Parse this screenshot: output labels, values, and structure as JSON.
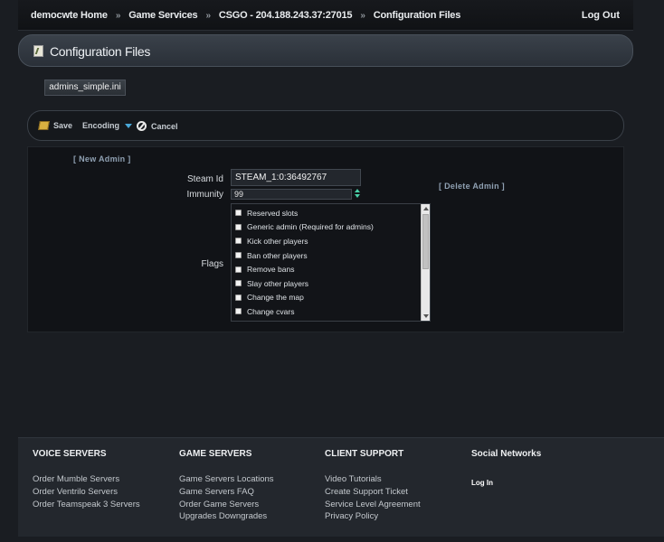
{
  "breadcrumb": {
    "items": [
      "democwte Home",
      "Game Services",
      "CSGO - 204.188.243.37:27015",
      "Configuration Files"
    ],
    "separator": "»"
  },
  "header": {
    "logout": "Log Out",
    "title": "Configuration Files"
  },
  "file_tab": {
    "label": "admins_simple.ini"
  },
  "toolbar": {
    "save": "Save",
    "encoding": "Encoding",
    "cancel": "Cancel"
  },
  "admin_form": {
    "new_admin": "[ New Admin ]",
    "delete_admin": "[ Delete Admin ]",
    "steam_id_label": "Steam Id",
    "steam_id_value": "STEAM_1:0:36492767",
    "immunity_label": "Immunity",
    "immunity_value": "99",
    "flags_label": "Flags",
    "flags": [
      {
        "label": "Reserved slots",
        "checked": false
      },
      {
        "label": "Generic admin (Required for admins)",
        "checked": false
      },
      {
        "label": "Kick other players",
        "checked": false
      },
      {
        "label": "Ban other players",
        "checked": false
      },
      {
        "label": "Remove bans",
        "checked": false
      },
      {
        "label": "Slay other players",
        "checked": false
      },
      {
        "label": "Change the map",
        "checked": false
      },
      {
        "label": "Change cvars",
        "checked": false
      }
    ]
  },
  "footer": {
    "voice": {
      "title": "VOICE SERVERS",
      "links": [
        "Order Mumble Servers",
        "Order Ventrilo Servers",
        "Order Teamspeak 3 Servers"
      ]
    },
    "game": {
      "title": "GAME SERVERS",
      "links": [
        "Game Servers Locations",
        "Game Servers FAQ",
        "Order Game Servers",
        "Upgrades Downgrades"
      ]
    },
    "support": {
      "title": "CLIENT SUPPORT",
      "links": [
        "Video Tutorials",
        "Create Support Ticket",
        "Service Level Agreement",
        "Privacy Policy"
      ]
    },
    "social": {
      "title": "Social Networks",
      "login": "Log In"
    }
  },
  "colors": {
    "accent_link": "#8fa0b2",
    "stepper": "#4ad0a8",
    "encoding_arrow": "#4aa8d8"
  }
}
